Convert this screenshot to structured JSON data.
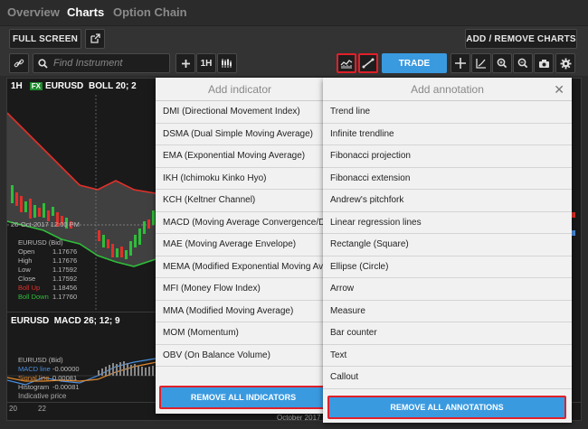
{
  "tabs": [
    {
      "label": "Overview"
    },
    {
      "label": "Charts"
    },
    {
      "label": "Option Chain"
    }
  ],
  "toolbar": {
    "full_screen": "FULL SCREEN",
    "add_remove_charts": "ADD / REMOVE CHARTS",
    "search_placeholder": "Find Instrument",
    "interval": "1H",
    "trade": "TRADE"
  },
  "chart": {
    "interval": "1H",
    "fx_badge": "FX",
    "instrument": "EURUSD",
    "indicator": "BOLL 20; 2",
    "crosshair_date": "26-Oct-2017 12:00 PM",
    "legend_title": "EURUSD (Bid)",
    "legend": [
      {
        "key": "Open",
        "value": "1.17676"
      },
      {
        "key": "High",
        "value": "1.17676"
      },
      {
        "key": "Low",
        "value": "1.17592"
      },
      {
        "key": "Close",
        "value": "1.17592"
      },
      {
        "key": "Boll Up",
        "value": "1.18456"
      },
      {
        "key": "Boll Down",
        "value": "1.17760"
      }
    ],
    "sub_title": "EURUSD  MACD 26; 12; 9",
    "sub_legend_title": "EURUSD (Bid)",
    "sub_legend": [
      {
        "key": "MACD line",
        "value": "-0.00000"
      },
      {
        "key": "Signal line",
        "value": "0.00081"
      },
      {
        "key": "Histogram",
        "value": "-0.00081"
      }
    ],
    "sub_footer": "Indicative price",
    "axis_labels": [
      "20",
      "22"
    ],
    "axis_month": "October 2017"
  },
  "indicator_panel": {
    "title": "Add indicator",
    "items": [
      "DMI (Directional Movement Index)",
      "DSMA (Dual Simple Moving Average)",
      "EMA (Exponential Moving Average)",
      "IKH (Ichimoku Kinko Hyo)",
      "KCH (Keltner Channel)",
      "MACD (Moving Average Convergence/Divergence)",
      "MAE (Moving Average Envelope)",
      "MEMA (Modified Exponential Moving Average)",
      "MFI (Money Flow Index)",
      "MMA (Modified Moving Average)",
      "MOM (Momentum)",
      "OBV (On Balance Volume)"
    ],
    "remove_all": "REMOVE ALL INDICATORS"
  },
  "annotation_panel": {
    "title": "Add annotation",
    "close": "✕",
    "items": [
      "Trend line",
      "Infinite trendline",
      "Fibonacci projection",
      "Fibonacci extension",
      "Andrew's pitchfork",
      "Linear regression lines",
      "Rectangle (Square)",
      "Ellipse (Circle)",
      "Arrow",
      "Measure",
      "Bar counter",
      "Text",
      "Callout"
    ],
    "remove_all": "REMOVE ALL ANNOTATIONS"
  },
  "colors": {
    "accent": "#3a9ae0",
    "highlight": "#e0202a",
    "bull": "#2ebd3a",
    "bear": "#e0302a"
  }
}
